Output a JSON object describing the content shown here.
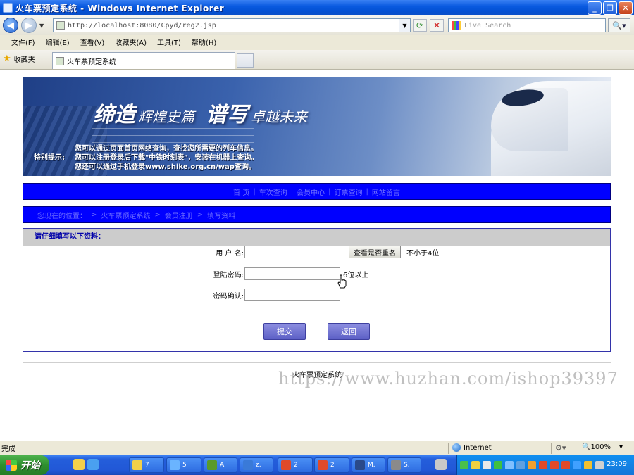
{
  "window": {
    "title": "火车票预定系统 - Windows Internet Explorer"
  },
  "addressbar": {
    "url": "http://localhost:8080/Cpyd/reg2.jsp",
    "search_placeholder": "Live Search"
  },
  "menu": [
    "文件(F)",
    "编辑(E)",
    "查看(V)",
    "收藏夹(A)",
    "工具(T)",
    "帮助(H)"
  ],
  "favorites_label": "收藏夹",
  "tab": {
    "label": "火车票预定系统"
  },
  "banner": {
    "slogan": [
      "缔造",
      "辉煌史篇",
      "谱写",
      "卓越未来"
    ],
    "tip_label": "特别提示:",
    "tips": [
      "您可以通过页面首页网络查询，查找您所需要的列车信息。",
      "您可以注册登录后下载\"中铁时刻表\"，安装在机器上查询。",
      "您还可以通过手机登录www.shike.org.cn/wap查询。"
    ]
  },
  "nav": [
    "首 页",
    "车次查询",
    "会员中心",
    "订票查询",
    "网站留言"
  ],
  "breadcrumb": [
    "您现在的位置：",
    "火车票预定系统",
    "会员注册",
    "填写资料"
  ],
  "form": {
    "heading": "请仔细填写以下资料：",
    "username_label": "用 户 名:",
    "username_value": "",
    "check_button": "查看是否重名",
    "username_hint": "不小于4位",
    "password_label": "登陆密码:",
    "password_value": "",
    "password_hint": "6位以上",
    "confirm_label": "密码确认:",
    "confirm_value": "",
    "submit": "提交",
    "reset": "返回"
  },
  "footer": {
    "text": "火车票预定系统",
    "watermark": "https://www.huzhan.com/ishop39397"
  },
  "statusbar": {
    "status": "完成",
    "zone": "Internet",
    "zoom": "100%"
  },
  "taskbar": {
    "start": "开始",
    "buttons": [
      "7",
      "5",
      "A.",
      "z.",
      "2",
      "2",
      "M.",
      "S."
    ],
    "clock": "23:09"
  }
}
